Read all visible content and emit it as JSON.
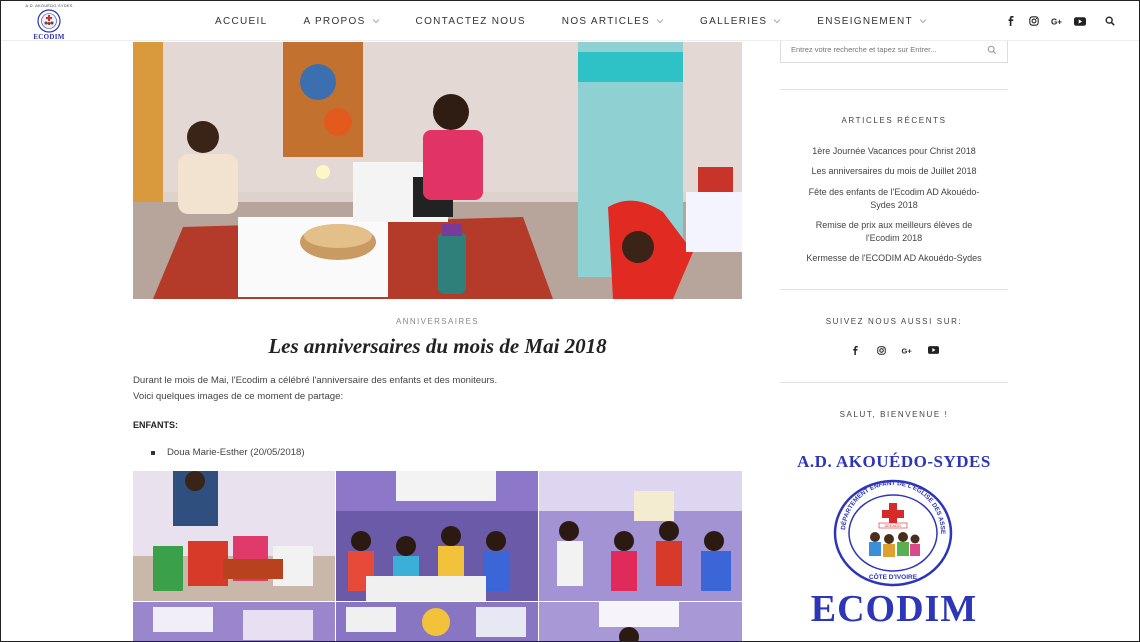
{
  "header": {
    "logo_top_text": "A.D. AKOUÉDO-SYDES",
    "logo_name": "ECODIM",
    "nav": [
      {
        "label": "ACCUEIL",
        "dropdown": false
      },
      {
        "label": "A PROPOS",
        "dropdown": true
      },
      {
        "label": "CONTACTEZ NOUS",
        "dropdown": false
      },
      {
        "label": "NOS ARTICLES",
        "dropdown": true
      },
      {
        "label": "GALLERIES",
        "dropdown": true
      },
      {
        "label": "ENSEIGNEMENT",
        "dropdown": true
      }
    ],
    "social_icons": [
      "facebook-icon",
      "instagram-icon",
      "google-plus-icon",
      "youtube-icon",
      "search-icon"
    ]
  },
  "post": {
    "category": "ANNIVERSAIRES",
    "title": "Les anniversaires du mois de Mai 2018",
    "intro_line1": "Durant le mois de Mai, l'Ecodim a  célébré l'anniversaire des enfants et des moniteurs.",
    "intro_line2": "Voici quelques images de ce moment de partage:",
    "section_label": "ENFANTS:",
    "children": [
      "Doua Marie-Esther (20/05/2018)"
    ]
  },
  "sidebar": {
    "search_placeholder": "Entrez votre recherche et tapez sur Entrer...",
    "recent_title": "ARTICLES RÉCENTS",
    "recent_posts": [
      {
        "line1": "1ère Journée Vacances pour Christ 2018",
        "line2": ""
      },
      {
        "line1": "Les anniversaires du mois de Juillet 2018",
        "line2": ""
      },
      {
        "line1": "Fête des enfants de l'Ecodim AD Akouédo-",
        "line2": "Sydes 2018"
      },
      {
        "line1": "Remise de prix aux meilleurs élèves de",
        "line2": "l'Ecodim 2018"
      },
      {
        "line1": "Kermesse de l'ECODIM AD Akouédo-Sydes",
        "line2": ""
      }
    ],
    "follow_title": "SUIVEZ NOUS AUSSI SUR:",
    "welcome_title": "SALUT, BIENVENUE !",
    "ad_title": "A.D. AKOUÉDO-SYDES",
    "seal_text": "DÉPARTEMENT ENFANT DE L'EGLISE DES ASSEMBLÉES DE DIEU",
    "seal_country": "CÔTE D'IVOIRE",
    "seal_badge": "DEEADCI",
    "ad_name": "ECODIM"
  },
  "colors": {
    "brand_blue": "#2d35b8",
    "seal_red": "#d42a2a",
    "text": "#333333",
    "muted": "#888888"
  }
}
